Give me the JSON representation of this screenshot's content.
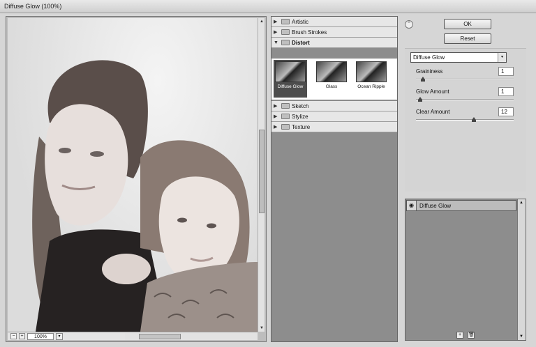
{
  "window": {
    "title": "Diffuse Glow (100%)"
  },
  "preview": {
    "zoom": "100%",
    "minus": "−",
    "plus": "+",
    "zoom_arrow": "▾",
    "up": "▲",
    "down": "▼"
  },
  "gallery": {
    "categories": [
      {
        "label": "Artistic",
        "open": false
      },
      {
        "label": "Brush Strokes",
        "open": false
      },
      {
        "label": "Distort",
        "open": true
      },
      {
        "label": "Sketch",
        "open": false
      },
      {
        "label": "Stylize",
        "open": false
      },
      {
        "label": "Texture",
        "open": false
      }
    ],
    "thumbnails": [
      {
        "label": "Diffuse Glow",
        "selected": true
      },
      {
        "label": "Glass",
        "selected": false
      },
      {
        "label": "Ocean Ripple",
        "selected": false
      }
    ]
  },
  "controls": {
    "collapse": "⌃",
    "ok": "OK",
    "reset": "Reset",
    "filter": "Diffuse Glow",
    "caret": "▾",
    "params": [
      {
        "label": "Graininess",
        "value": "1",
        "fraction": 0.05
      },
      {
        "label": "Glow Amount",
        "value": "1",
        "fraction": 0.02
      },
      {
        "label": "Clear Amount",
        "value": "12",
        "fraction": 0.6
      }
    ]
  },
  "layers": {
    "items": [
      {
        "label": "Diffuse Glow",
        "eye": "◉"
      }
    ],
    "up": "▲",
    "down": "▼",
    "new": "+",
    "delete": "🗑"
  },
  "colors": {
    "selection": "#4d4d4d",
    "panel_bg": "#8d8d8d"
  }
}
